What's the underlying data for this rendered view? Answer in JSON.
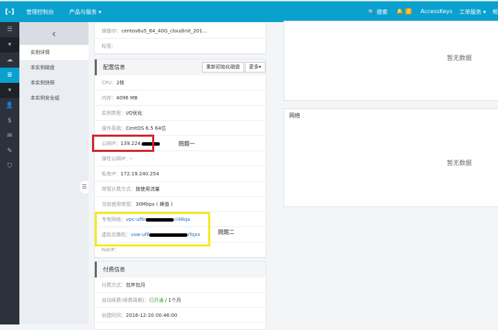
{
  "topbar": {
    "logo": "[-]",
    "console": "管理控制台",
    "products": "产品与服务 ▾",
    "search": "🔍 搜索",
    "bell": "🔔",
    "badge": "4",
    "accesskeys": "AccessKeys",
    "tickets": "工单服务 ▾",
    "more": "帮"
  },
  "rail": {
    "icons": [
      "☰",
      "▾",
      "☁",
      "≣",
      "▾",
      "👤",
      "$",
      "✉",
      "✎",
      "⛉"
    ]
  },
  "submenu": {
    "back": "‹",
    "items": [
      "实例详情",
      "本实例磁盘",
      "本实例快照",
      "本实例安全组"
    ],
    "collapse": "☰"
  },
  "basic": {
    "image_label": "镜像ID：",
    "image_value": "centos6u5_64_40G_cloudinit_201...",
    "tag_label": "标签："
  },
  "config": {
    "title": "配置信息",
    "reinit": "重新初始化磁盘",
    "more": "更多▾",
    "rows": [
      [
        "CPU：",
        "2核"
      ],
      [
        "内存：",
        "4096 MB"
      ],
      [
        "实例类型：",
        "I/O优化"
      ],
      [
        "操作系统：",
        "CentOS 6.5 64位"
      ],
      [
        "公网IP：",
        "139.224."
      ],
      [
        "弹性公网IP：",
        "-"
      ],
      [
        "私有IP：",
        "172.19.240.254"
      ],
      [
        "带宽计费方式：",
        "按使用流量"
      ],
      [
        "当前使用带宽：",
        "30Mbps ( 峰值 )"
      ],
      [
        "专有网络：",
        "vpc-uf6r",
        "ci48qa"
      ],
      [
        "虚拟交换机：",
        "vsw-uf6",
        "rfqxx"
      ],
      [
        "NatIP：",
        ""
      ]
    ]
  },
  "billing": {
    "title": "付费信息",
    "rows": [
      [
        "付费方式：",
        "包年包月"
      ],
      [
        "自动续费(续费周期)：",
        "已开通",
        "/ 1个月"
      ],
      [
        "创建时间：",
        "2016-12-20 00:46:00"
      ]
    ]
  },
  "right": {
    "nodata1": "暂无数据",
    "network": "网络",
    "nodata2": "暂无数据"
  },
  "annotations": {
    "q1": "問題一",
    "q2": "問題二"
  },
  "colors": {
    "topbar": "#0aa1cf",
    "red": "#d0262b",
    "yellow": "#f5ea1c"
  }
}
